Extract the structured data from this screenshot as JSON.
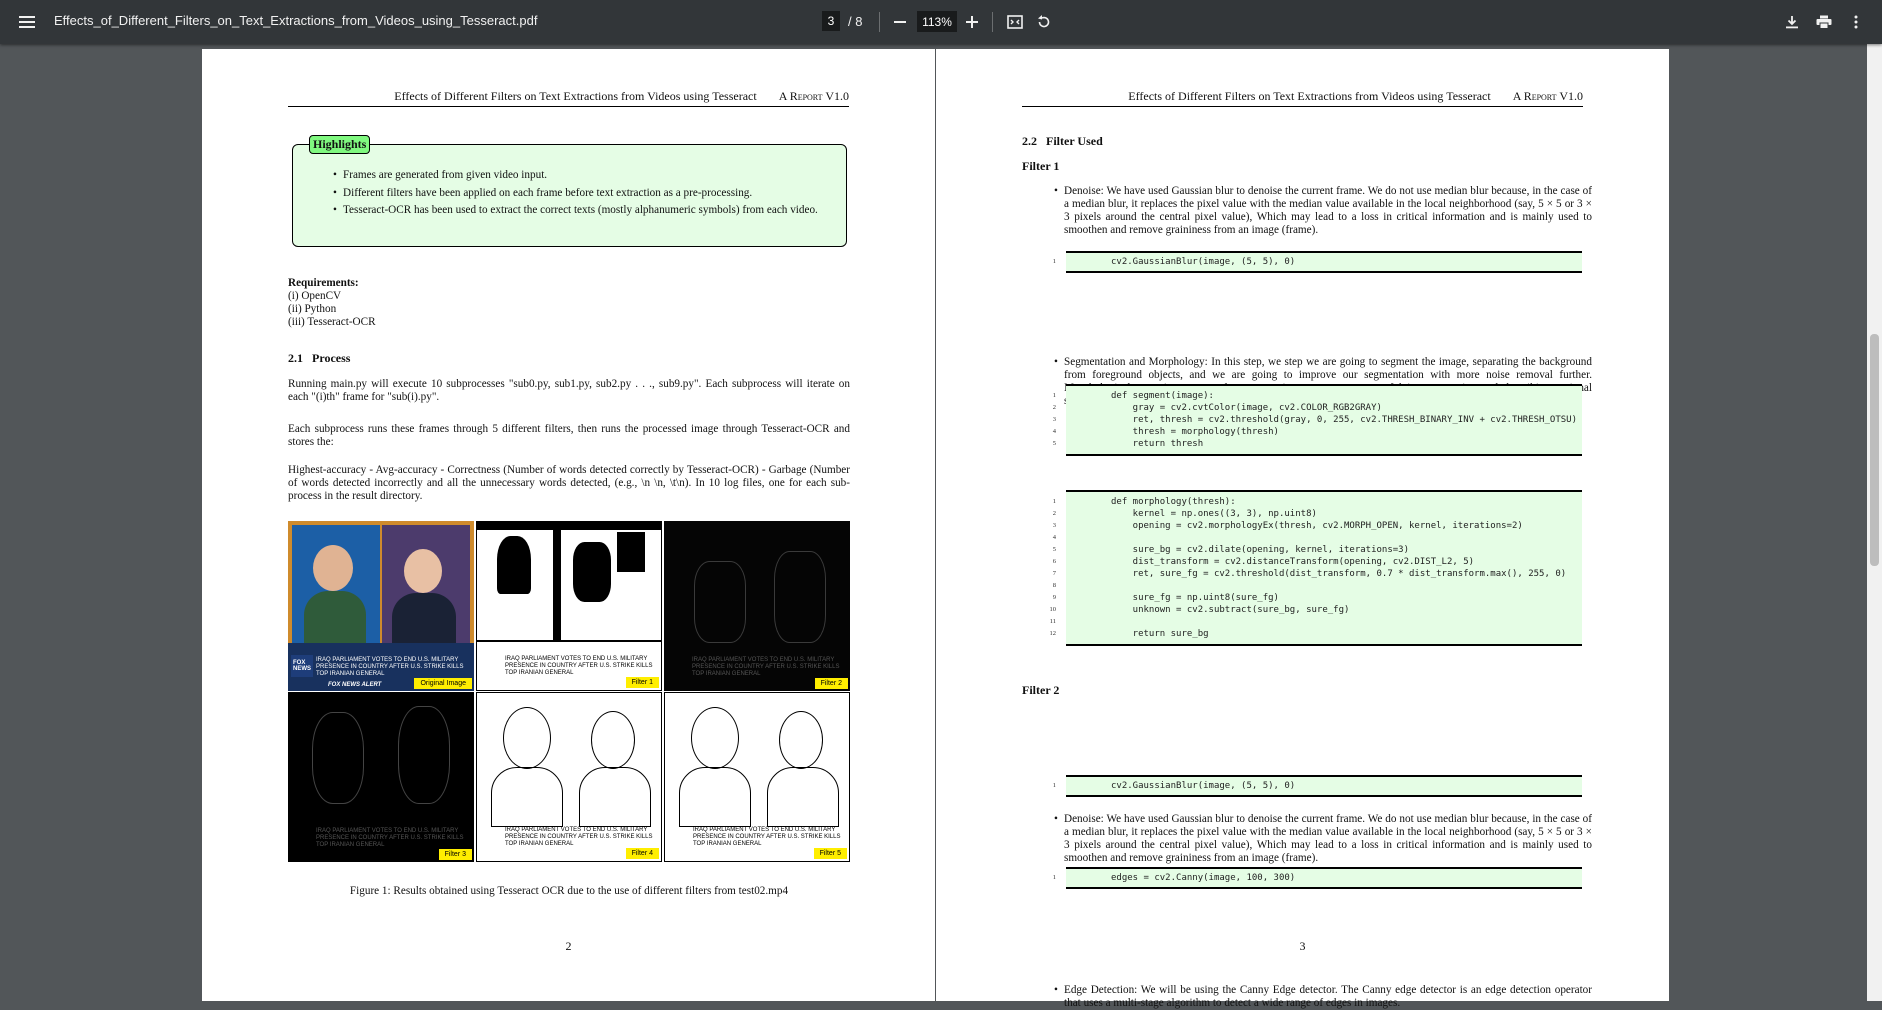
{
  "toolbar": {
    "title": "Effects_of_Different_Filters_on_Text_Extractions_from_Videos_using_Tesseract.pdf",
    "current_page": "3",
    "total_pages": "/ 8",
    "zoom": "113%",
    "icons": [
      "menu-icon",
      "zoom-out-icon",
      "zoom-in-icon",
      "fit-page-icon",
      "rotate-icon",
      "download-icon",
      "print-icon",
      "more-vert-icon"
    ]
  },
  "colors": {
    "toolbar_bg": "#323639",
    "viewer_bg": "#525659",
    "highlight_bg": "#e5fde5",
    "highlight_tag": "#80f880",
    "filter_label": "#ffee00"
  },
  "left_page": {
    "running_title": "Effects of Different Filters on Text Extractions from Videos using Tesseract",
    "running_report": "A Report V1.0",
    "highlights_title": "Highlights",
    "highlights": [
      "Frames are generated from given video input.",
      "Different filters have been applied on each frame before text extraction as a pre-processing.",
      "Tesseract-OCR has been used to extract the correct texts (mostly alphanumeric symbols) from each video."
    ],
    "requirements_heading": "Requirements:",
    "requirements": [
      "(i) OpenCV",
      "(ii) Python",
      "(iii) Tesseract-OCR"
    ],
    "section_num": "2.1",
    "section_title": "Process",
    "para1": "Running main.py will execute 10 subprocesses \"sub0.py, sub1.py, sub2.py . . ., sub9.py\". Each subprocess will iterate on each \"(i)th\" frame for \"sub(i).py\".",
    "para2": "Each subprocess runs these frames through 5 different filters, then runs the processed image through Tesseract-OCR and stores the:",
    "para3": "Highest-accuracy - Avg-accuracy - Correctness (Number of words detected correctly by Tesseract-OCR) - Garbage (Number of words detected incorrectly and all the unnecessary words detected, (e.g., \\n \\n, \\t\\n). In 10 log files, one for each sub-process in the result directory.",
    "figure_labels": [
      "Original Image",
      "Filter 1",
      "Filter 2",
      "Filter 3",
      "Filter 4",
      "Filter 5"
    ],
    "ticker_text": "IRAQ PARLIAMENT VOTES TO END U.S. MILITARY PRESENCE IN COUNTRY AFTER U.S. STRIKE KILLS TOP IRANIAN GENERAL",
    "news_alert": "FOX NEWS ALERT",
    "caption": "Figure 1: Results obtained using Tesseract OCR due to the use of different filters from test02.mp4",
    "page_number": "2"
  },
  "right_page": {
    "running_title": "Effects of Different Filters on Text Extractions from Videos using Tesseract",
    "running_report": "A Report V1.0",
    "section_num": "2.2",
    "section_title": "Filter Used",
    "filter1_title": "Filter 1",
    "denoise_text": "Denoise: We have used Gaussian blur to denoise the current frame. We do not use median blur because, in the case of a median blur, it replaces the pixel value with the median value available in the local neighborhood (say, 5 × 5 or 3 × 3 pixels around the central pixel value), Which may lead to a loss in critical information and is mainly used to smoothen and remove graininess from an image (frame).",
    "code_blur": [
      "cv2.GaussianBlur(image, (5, 5), 0)"
    ],
    "seg_text": "Segmentation and Morphology: In this step, we step we are going to segment the image, separating the background from foreground objects, and we are going to improve our segmentation with more noise removal further. Morphological operations are used to extract image components useful in representing and describing regional shapes.",
    "code_segment": [
      "def segment(image):",
      "    gray = cv2.cvtColor(image, cv2.COLOR_RGB2GRAY)",
      "    ret, thresh = cv2.threshold(gray, 0, 255, cv2.THRESH_BINARY_INV + cv2.THRESH_OTSU)",
      "    thresh = morphology(thresh)",
      "    return thresh"
    ],
    "code_morph": [
      "def morphology(thresh):",
      "    kernel = np.ones((3, 3), np.uint8)",
      "    opening = cv2.morphologyEx(thresh, cv2.MORPH_OPEN, kernel, iterations=2)",
      "",
      "    sure_bg = cv2.dilate(opening, kernel, iterations=3)",
      "    dist_transform = cv2.distanceTransform(opening, cv2.DIST_L2, 5)",
      "    ret, sure_fg = cv2.threshold(dist_transform, 0.7 * dist_transform.max(), 255, 0)",
      "",
      "    sure_fg = np.uint8(sure_fg)",
      "    unknown = cv2.subtract(sure_bg, sure_fg)",
      "",
      "    return sure_bg"
    ],
    "filter2_title": "Filter 2",
    "denoise_text2": "Denoise: We have used Gaussian blur to denoise the current frame. We do not use median blur because, in the case of a median blur, it replaces the pixel value with the median value available in the local neighborhood (say, 5 × 5 or 3 × 3 pixels around the central pixel value), Which may lead to a loss in critical information and is mainly used to smoothen and remove graininess from an image (frame).",
    "code_blur2": [
      "cv2.GaussianBlur(image, (5, 5), 0)"
    ],
    "edge_text": "Edge Detection: We will be using the Canny Edge detector. The Canny edge detector is an edge detection operator that uses a multi-stage algorithm to detect a wide range of edges in images.",
    "code_canny": [
      "edges = cv2.Canny(image, 100, 300)"
    ],
    "page_number": "3"
  }
}
